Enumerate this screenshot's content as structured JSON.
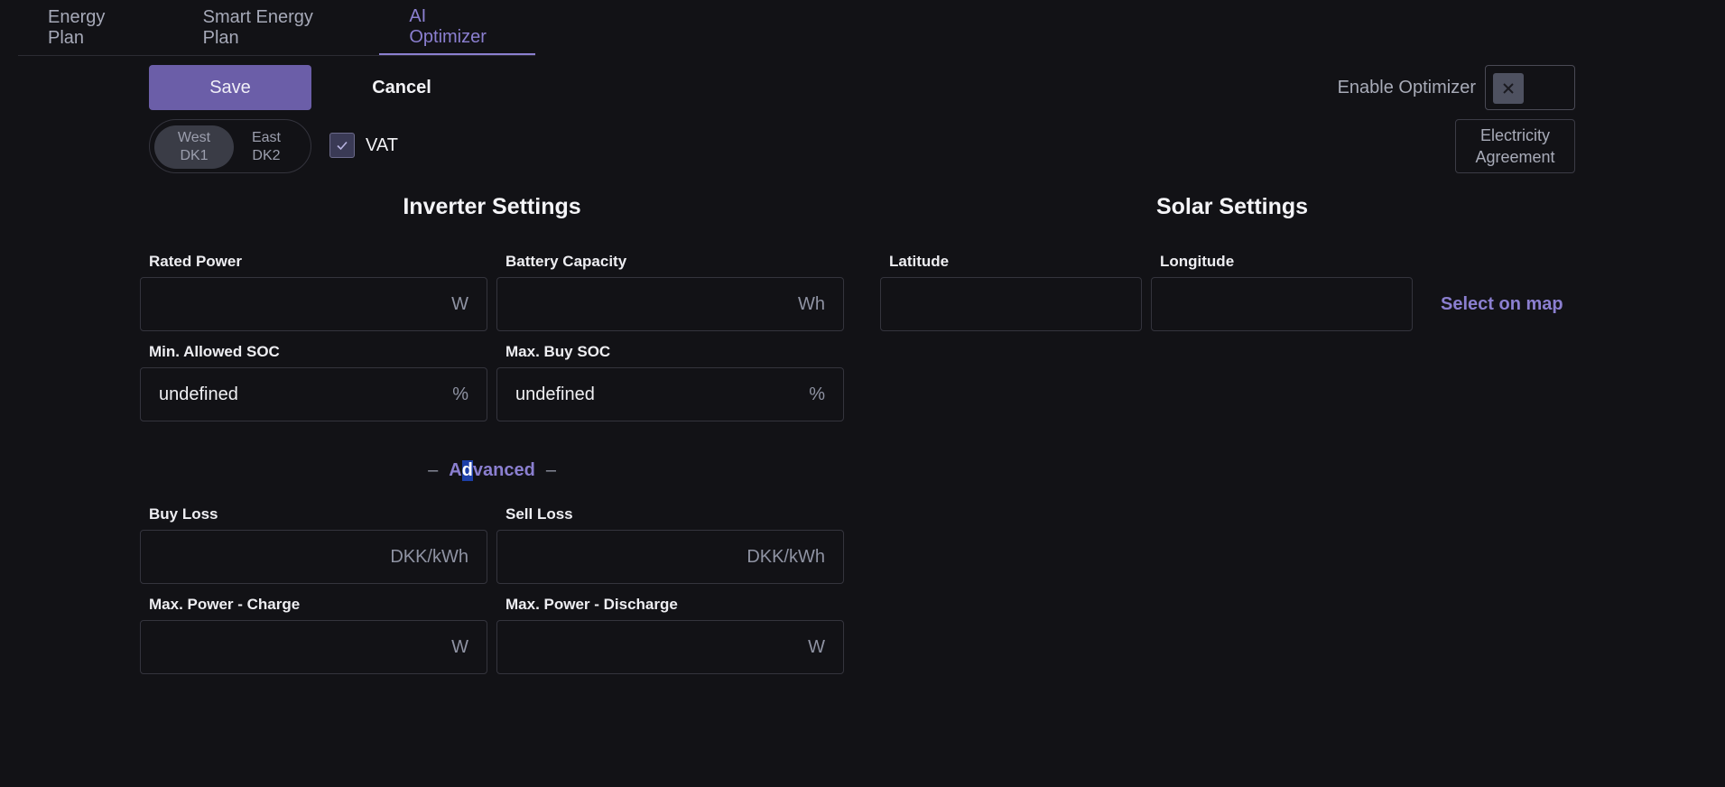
{
  "tabs": [
    {
      "label": "Energy Plan"
    },
    {
      "label": "Smart Energy Plan"
    },
    {
      "label": "AI Optimizer"
    }
  ],
  "active_tab": "AI Optimizer",
  "toolbar": {
    "save_label": "Save",
    "cancel_label": "Cancel",
    "enable_optimizer_label": "Enable Optimizer",
    "enable_optimizer_checked": false,
    "electricity_agreement_line1": "Electricity",
    "electricity_agreement_line2": "Agreement"
  },
  "region_toggle": {
    "options": [
      {
        "line1": "West",
        "line2": "DK1",
        "selected": true
      },
      {
        "line1": "East",
        "line2": "DK2",
        "selected": false
      }
    ]
  },
  "vat": {
    "label": "VAT",
    "checked": true
  },
  "inverter": {
    "title": "Inverter Settings",
    "rated_power": {
      "label": "Rated Power",
      "value": "",
      "unit": "W"
    },
    "battery_capacity": {
      "label": "Battery Capacity",
      "value": "",
      "unit": "Wh"
    },
    "min_soc": {
      "label": "Min. Allowed SOC",
      "value": "undefined",
      "unit": "%"
    },
    "max_buy_soc": {
      "label": "Max. Buy SOC",
      "value": "undefined",
      "unit": "%"
    }
  },
  "advanced": {
    "label_prefix": "A",
    "label_highlight": "d",
    "label_suffix": "vanced",
    "dash": "–",
    "buy_loss": {
      "label": "Buy Loss",
      "value": "",
      "unit": "DKK/kWh"
    },
    "sell_loss": {
      "label": "Sell Loss",
      "value": "",
      "unit": "DKK/kWh"
    },
    "max_power_charge": {
      "label": "Max. Power - Charge",
      "value": "",
      "unit": "W"
    },
    "max_power_discharge": {
      "label": "Max. Power - Discharge",
      "value": "",
      "unit": "W"
    }
  },
  "solar": {
    "title": "Solar Settings",
    "latitude": {
      "label": "Latitude",
      "value": ""
    },
    "longitude": {
      "label": "Longitude",
      "value": ""
    },
    "select_on_map_label": "Select on map"
  },
  "icons": {
    "vat_check": "check-icon",
    "optimizer_x": "close-icon"
  },
  "colors": {
    "accent": "#8b7fd0",
    "save_button": "#6b5ea8",
    "background": "#121216"
  }
}
